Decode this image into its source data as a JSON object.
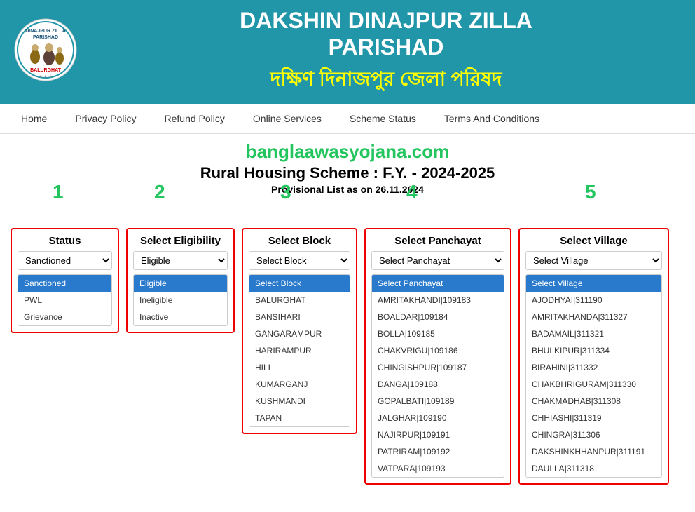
{
  "header": {
    "title_en_line1": "DAKSHIN DINAJPUR ZILLA",
    "title_en_line2": "PARISHAD",
    "title_bn": "দক্ষিণ দিনাজপুর জেলা পরিষদ",
    "logo_alt": "Dakshin Dinajpur Zilla Parishad Logo"
  },
  "nav": {
    "items": [
      {
        "label": "Home",
        "id": "home"
      },
      {
        "label": "Privacy Policy",
        "id": "privacy-policy"
      },
      {
        "label": "Refund Policy",
        "id": "refund-policy"
      },
      {
        "label": "Online Services",
        "id": "online-services"
      },
      {
        "label": "Scheme Status",
        "id": "scheme-status"
      },
      {
        "label": "Terms And Conditions",
        "id": "terms-conditions"
      }
    ]
  },
  "main": {
    "watermark": "banglaawasyojana.com",
    "scheme_title": "Rural Housing Scheme : F.Y. - 2024-2025",
    "provisional_date": "Provisional List as on 26.11.2024",
    "filters": {
      "status": {
        "step": "1",
        "label": "Status",
        "selected": "Sanctioned",
        "options": [
          "Sanctioned",
          "PWL",
          "Grievance"
        ],
        "highlighted": "Sanctioned"
      },
      "eligibility": {
        "step": "2",
        "label": "Select Eligibility",
        "selected": "Eligible",
        "options": [
          "Eligible",
          "Ineligible",
          "Inactive"
        ],
        "highlighted": "Eligible"
      },
      "block": {
        "step": "3",
        "label": "Select Block",
        "selected": "Select Block",
        "options": [
          "Select Block",
          "BALURGHAT",
          "BANSIHARI",
          "GANGARAMPUR",
          "HARIRAMPUR",
          "HILI",
          "KUMARGANJ",
          "KUSHMANDI",
          "TAPAN"
        ],
        "highlighted": "Select Block"
      },
      "panchayat": {
        "step": "4",
        "label": "Select Panchayat",
        "selected": "Select Panchayat",
        "options": [
          "Select Panchayat",
          "AMRITAKHANDI|109183",
          "BOALDAR|109184",
          "BOLLA|109185",
          "CHAKvrigu|109186",
          "CHINGISHPUR|109187",
          "DANGA|109188",
          "GOPALBATI|109189",
          "JALGHAR|109190",
          "NAJIRPUR|109191",
          "PATRIRAM|109192",
          "VATPARA|109193"
        ],
        "highlighted": "Select Panchayat"
      },
      "village": {
        "step": "5",
        "label": "Select Village",
        "selected": "Select Village",
        "options": [
          "Select Village",
          "AJODHYAI|311190",
          "AMRITAKHANDA|311327",
          "BADAMAIL|311321",
          "BHULKIPUR|311334",
          "BIRAHINI|311332",
          "CHAKBHRIGURAM|311330",
          "CHAKMADHAB|311308",
          "CHHIASHI|311319",
          "CHINGRA|311306",
          "DAKSHINKHHANPUR|311191",
          "DAULLA|311318"
        ],
        "highlighted": "Select Village"
      }
    }
  }
}
